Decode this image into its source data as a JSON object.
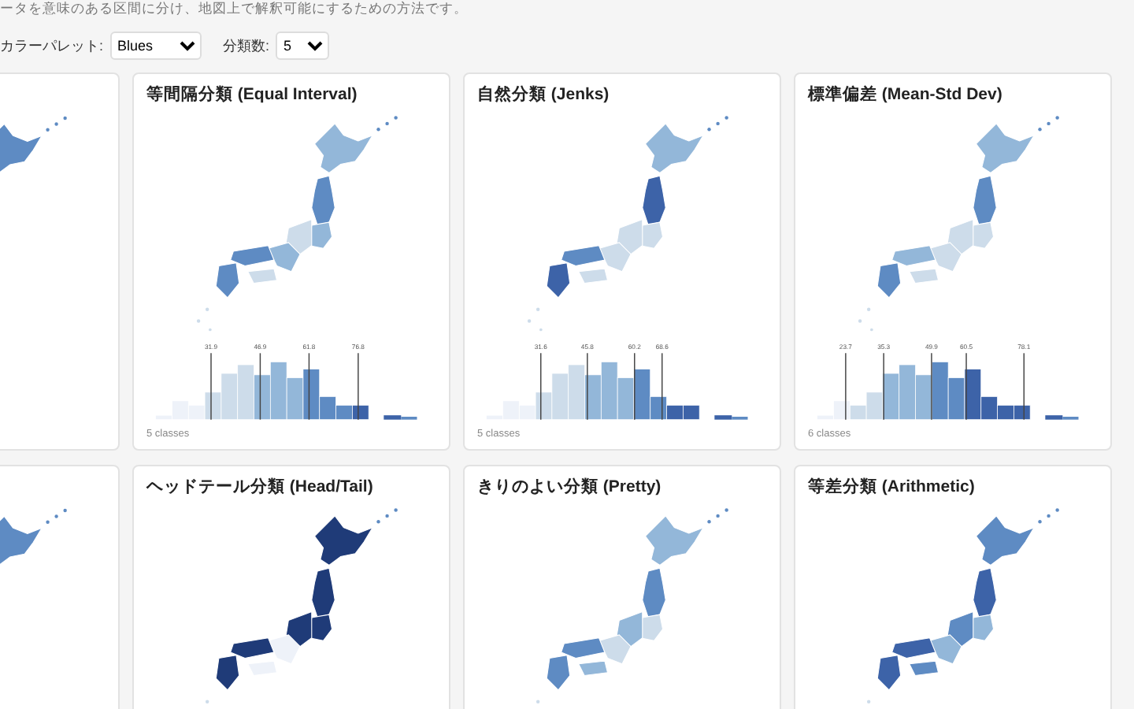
{
  "description": "ータを意味のある区間に分け、地図上で解釈可能にするための方法です。",
  "controls": [
    {
      "label": "カラーパレット:",
      "value": "Blues",
      "kind": "wide"
    },
    {
      "label": "分類数:",
      "value": "5",
      "kind": "narrow"
    }
  ],
  "cards": [
    {
      "kind": "cut"
    },
    {
      "kind": "equal",
      "title": "等間隔分類 (Equal Interval)",
      "breaks": [
        "31.9",
        "46.9",
        "61.8",
        "76.8"
      ],
      "caption": "5 classes"
    },
    {
      "kind": "jenks",
      "title": "自然分類 (Jenks)",
      "breaks": [
        "31.6",
        "45.8",
        "60.2",
        "68.6"
      ],
      "caption": "5 classes"
    },
    {
      "kind": "std",
      "title": "標準偏差 (Mean-Std Dev)",
      "breaks": [
        "23.7",
        "35.3",
        "49.9",
        "60.5",
        "78.1"
      ],
      "caption": "6 classes"
    },
    {
      "kind": "cut"
    },
    {
      "kind": "headtail",
      "title": "ヘッドテール分類 (Head/Tail)"
    },
    {
      "kind": "pretty",
      "title": "きりのよい分類 (Pretty)"
    },
    {
      "kind": "arith",
      "title": "等差分類 (Arithmetic)"
    }
  ]
}
